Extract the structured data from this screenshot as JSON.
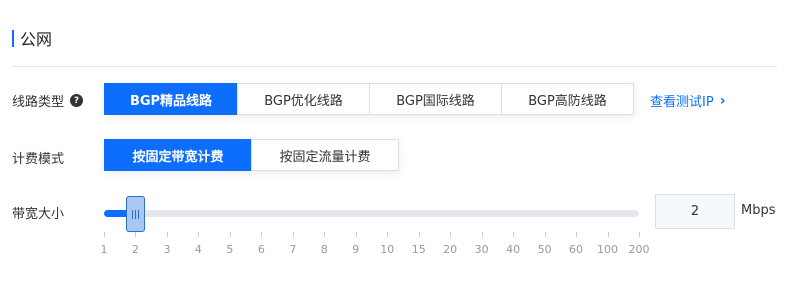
{
  "section": {
    "title": "公网"
  },
  "line_type": {
    "label": "线路类型",
    "help_icon": "question-circle-icon",
    "options": [
      "BGP精品线路",
      "BGP优化线路",
      "BGP国际线路",
      "BGP高防线路"
    ],
    "selected": "BGP精品线路",
    "test_ip_link": "查看测试IP",
    "link_icon": "chevron-right-icon"
  },
  "billing": {
    "label": "计费模式",
    "options": [
      "按固定带宽计费",
      "按固定流量计费"
    ],
    "selected": "按固定带宽计费"
  },
  "bandwidth": {
    "label": "带宽大小",
    "value": "2",
    "unit": "Mbps",
    "ticks": [
      "1",
      "2",
      "3",
      "4",
      "5",
      "6",
      "7",
      "8",
      "9",
      "10",
      "15",
      "20",
      "30",
      "40",
      "50",
      "60",
      "100",
      "200"
    ],
    "handle_icon": "grip-lines-icon"
  },
  "colors": {
    "accent": "#0d6efd",
    "track": "#e4e7ee",
    "handle": "#a8c8f3"
  }
}
